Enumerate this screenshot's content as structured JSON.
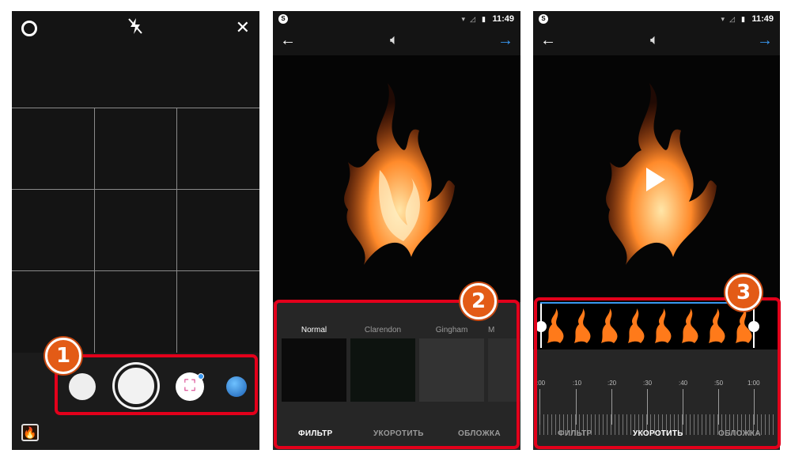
{
  "status": {
    "time": "11:49"
  },
  "panel1": {
    "icons": {
      "settings": "gear-icon",
      "flash": "flash-off-icon",
      "close": "close-icon"
    }
  },
  "panel2": {
    "filters": [
      "Normal",
      "Clarendon",
      "Gingham",
      "M"
    ],
    "tabs": [
      "ФИЛЬТР",
      "УКОРОТИТЬ",
      "ОБЛОЖКА"
    ],
    "active_tab": "ФИЛЬТР"
  },
  "panel3": {
    "timeline_labels": [
      ":00",
      ":10",
      ":20",
      ":30",
      ":40",
      ":50",
      "1:00"
    ],
    "tabs": [
      "ФИЛЬТР",
      "УКОРОТИТЬ",
      "ОБЛОЖКА"
    ],
    "active_tab": "УКОРОТИТЬ"
  },
  "callouts": [
    "1",
    "2",
    "3"
  ],
  "colors": {
    "highlight": "#e3001b",
    "callout": "#e35b16",
    "accent": "#3897f0"
  }
}
